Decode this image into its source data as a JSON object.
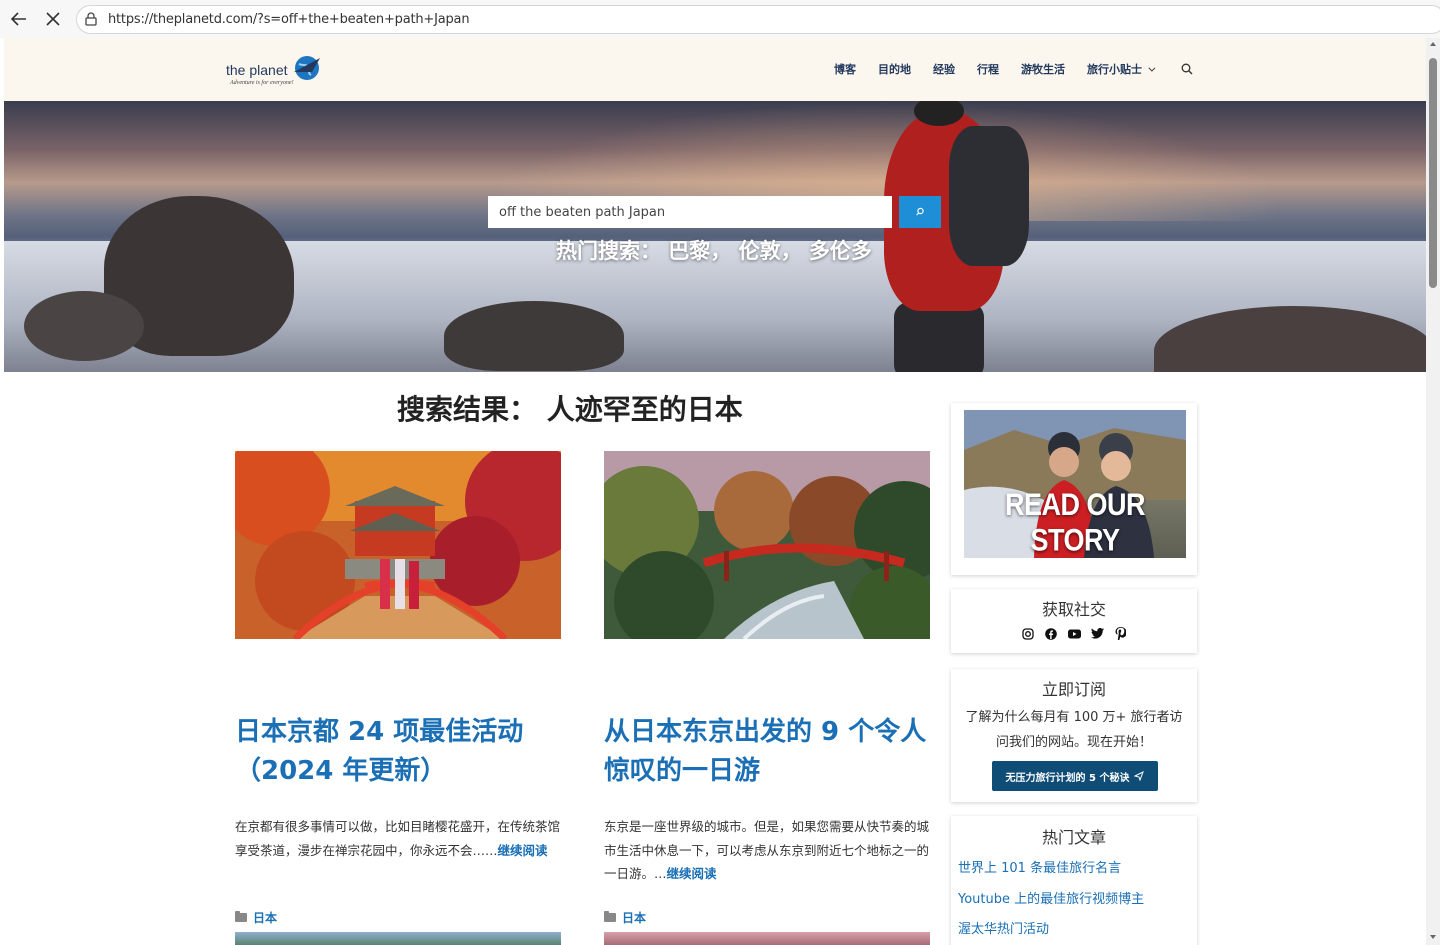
{
  "browser": {
    "url": "https://theplanetd.com/?s=off+the+beaten+path+Japan"
  },
  "header": {
    "logo_text": "the planet",
    "logo_tagline": "Adventure is for everyone!",
    "nav": [
      "博客",
      "目的地",
      "经验",
      "行程",
      "游牧生活",
      "旅行小贴士"
    ]
  },
  "hero": {
    "search_value": "off the beaten path Japan",
    "popular_label": "热门搜索： 巴黎， 伦敦， 多伦多"
  },
  "results": {
    "title": "搜索结果： 人迹罕至的日本",
    "posts": [
      {
        "title": "日本京都 24 项最佳活动（2024 年更新）",
        "excerpt": "在京都有很多事情可以做，比如目睹樱花盛开，在传统茶馆享受茶道，漫步在禅宗花园中，你永远不会……",
        "read_more": "继续阅读",
        "category": "日本"
      },
      {
        "title": "从日本东京出发的 9 个令人惊叹的一日游",
        "excerpt": "东京是一座世界级的城市。但是，如果您需要从快节奏的城市生活中休息一下，可以考虑从东京到附近七个地标之一的一日游。…",
        "read_more": "继续阅读",
        "category": "日本"
      }
    ]
  },
  "sidebar": {
    "story_label": "READ OUR STORY",
    "social_title": "获取社交",
    "social_icons": [
      "instagram-icon",
      "facebook-icon",
      "youtube-icon",
      "twitter-icon",
      "pinterest-icon"
    ],
    "subscribe_title": "立即订阅",
    "subscribe_text": "了解为什么每月有 100 万+ 旅行者访问我们的网站。现在开始！",
    "subscribe_button": "无压力旅行计划的 5 个秘诀",
    "popular_title": "热门文章",
    "popular_links": [
      "世界上 101 条最佳旅行名言",
      "Youtube 上的最佳旅行视频博主",
      "渥太华热门活动"
    ]
  },
  "colors": {
    "accent": "#1a6fb5",
    "header_bg": "#fbf6ee",
    "search_button": "#1e8fd6",
    "subscribe_button": "#0f4d77"
  }
}
